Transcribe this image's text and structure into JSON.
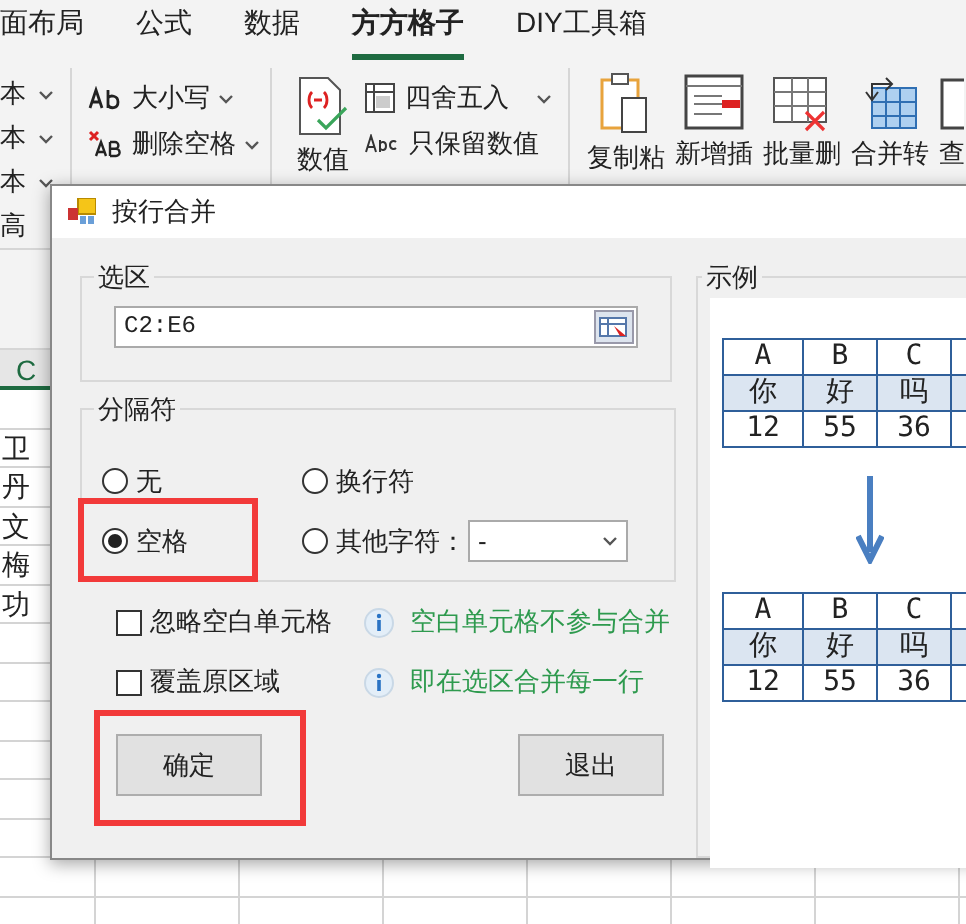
{
  "ribbon": {
    "tabs": [
      {
        "label": "面布局",
        "selected": false
      },
      {
        "label": "公式",
        "selected": false
      },
      {
        "label": "数据",
        "selected": false
      },
      {
        "label": "方方格子",
        "selected": true
      },
      {
        "label": "DIY工具箱",
        "selected": false
      }
    ],
    "text_menus": [
      "本",
      "本",
      "本"
    ],
    "text_tools": [
      "大小写",
      "删除空格"
    ],
    "number_button": "数值",
    "number_tools": [
      "四舍五入",
      "只保留数值"
    ],
    "big_buttons": [
      "复制粘",
      "新增插",
      "批量删",
      "合并转",
      "查"
    ],
    "advanced": "高"
  },
  "sheet": {
    "column_header": "C",
    "cells": [
      "卫",
      "丹",
      "文",
      "梅",
      "功"
    ]
  },
  "dialog": {
    "title": "按行合并",
    "range_group": {
      "title": "选区",
      "value": "C2:E6"
    },
    "separator_group": {
      "title": "分隔符",
      "options": [
        {
          "label": "无",
          "selected": false,
          "highlighted": false
        },
        {
          "label": "换行符",
          "selected": false,
          "highlighted": false
        },
        {
          "label": "空格",
          "selected": true,
          "highlighted": true
        },
        {
          "label": "其他字符：",
          "selected": false,
          "highlighted": false
        }
      ],
      "other_value": "-"
    },
    "options": [
      {
        "label": "忽略空白单元格",
        "checked": false,
        "hint": "空白单元格不参与合并"
      },
      {
        "label": "覆盖原区域",
        "checked": false,
        "hint": "即在选区合并每一行"
      }
    ],
    "buttons": [
      {
        "label": "确定",
        "highlighted": true
      },
      {
        "label": "退出",
        "highlighted": false
      }
    ],
    "example": {
      "title": "示例",
      "before": {
        "headers": [
          "A",
          "B",
          "C"
        ],
        "rows": [
          [
            "你",
            "好",
            "吗"
          ],
          [
            "12",
            "55",
            "36"
          ]
        ]
      },
      "after": {
        "headers": [
          "A",
          "B",
          "C"
        ],
        "rows": [
          [
            "你",
            "好",
            "吗"
          ],
          [
            "12",
            "55",
            "36"
          ]
        ]
      }
    }
  }
}
